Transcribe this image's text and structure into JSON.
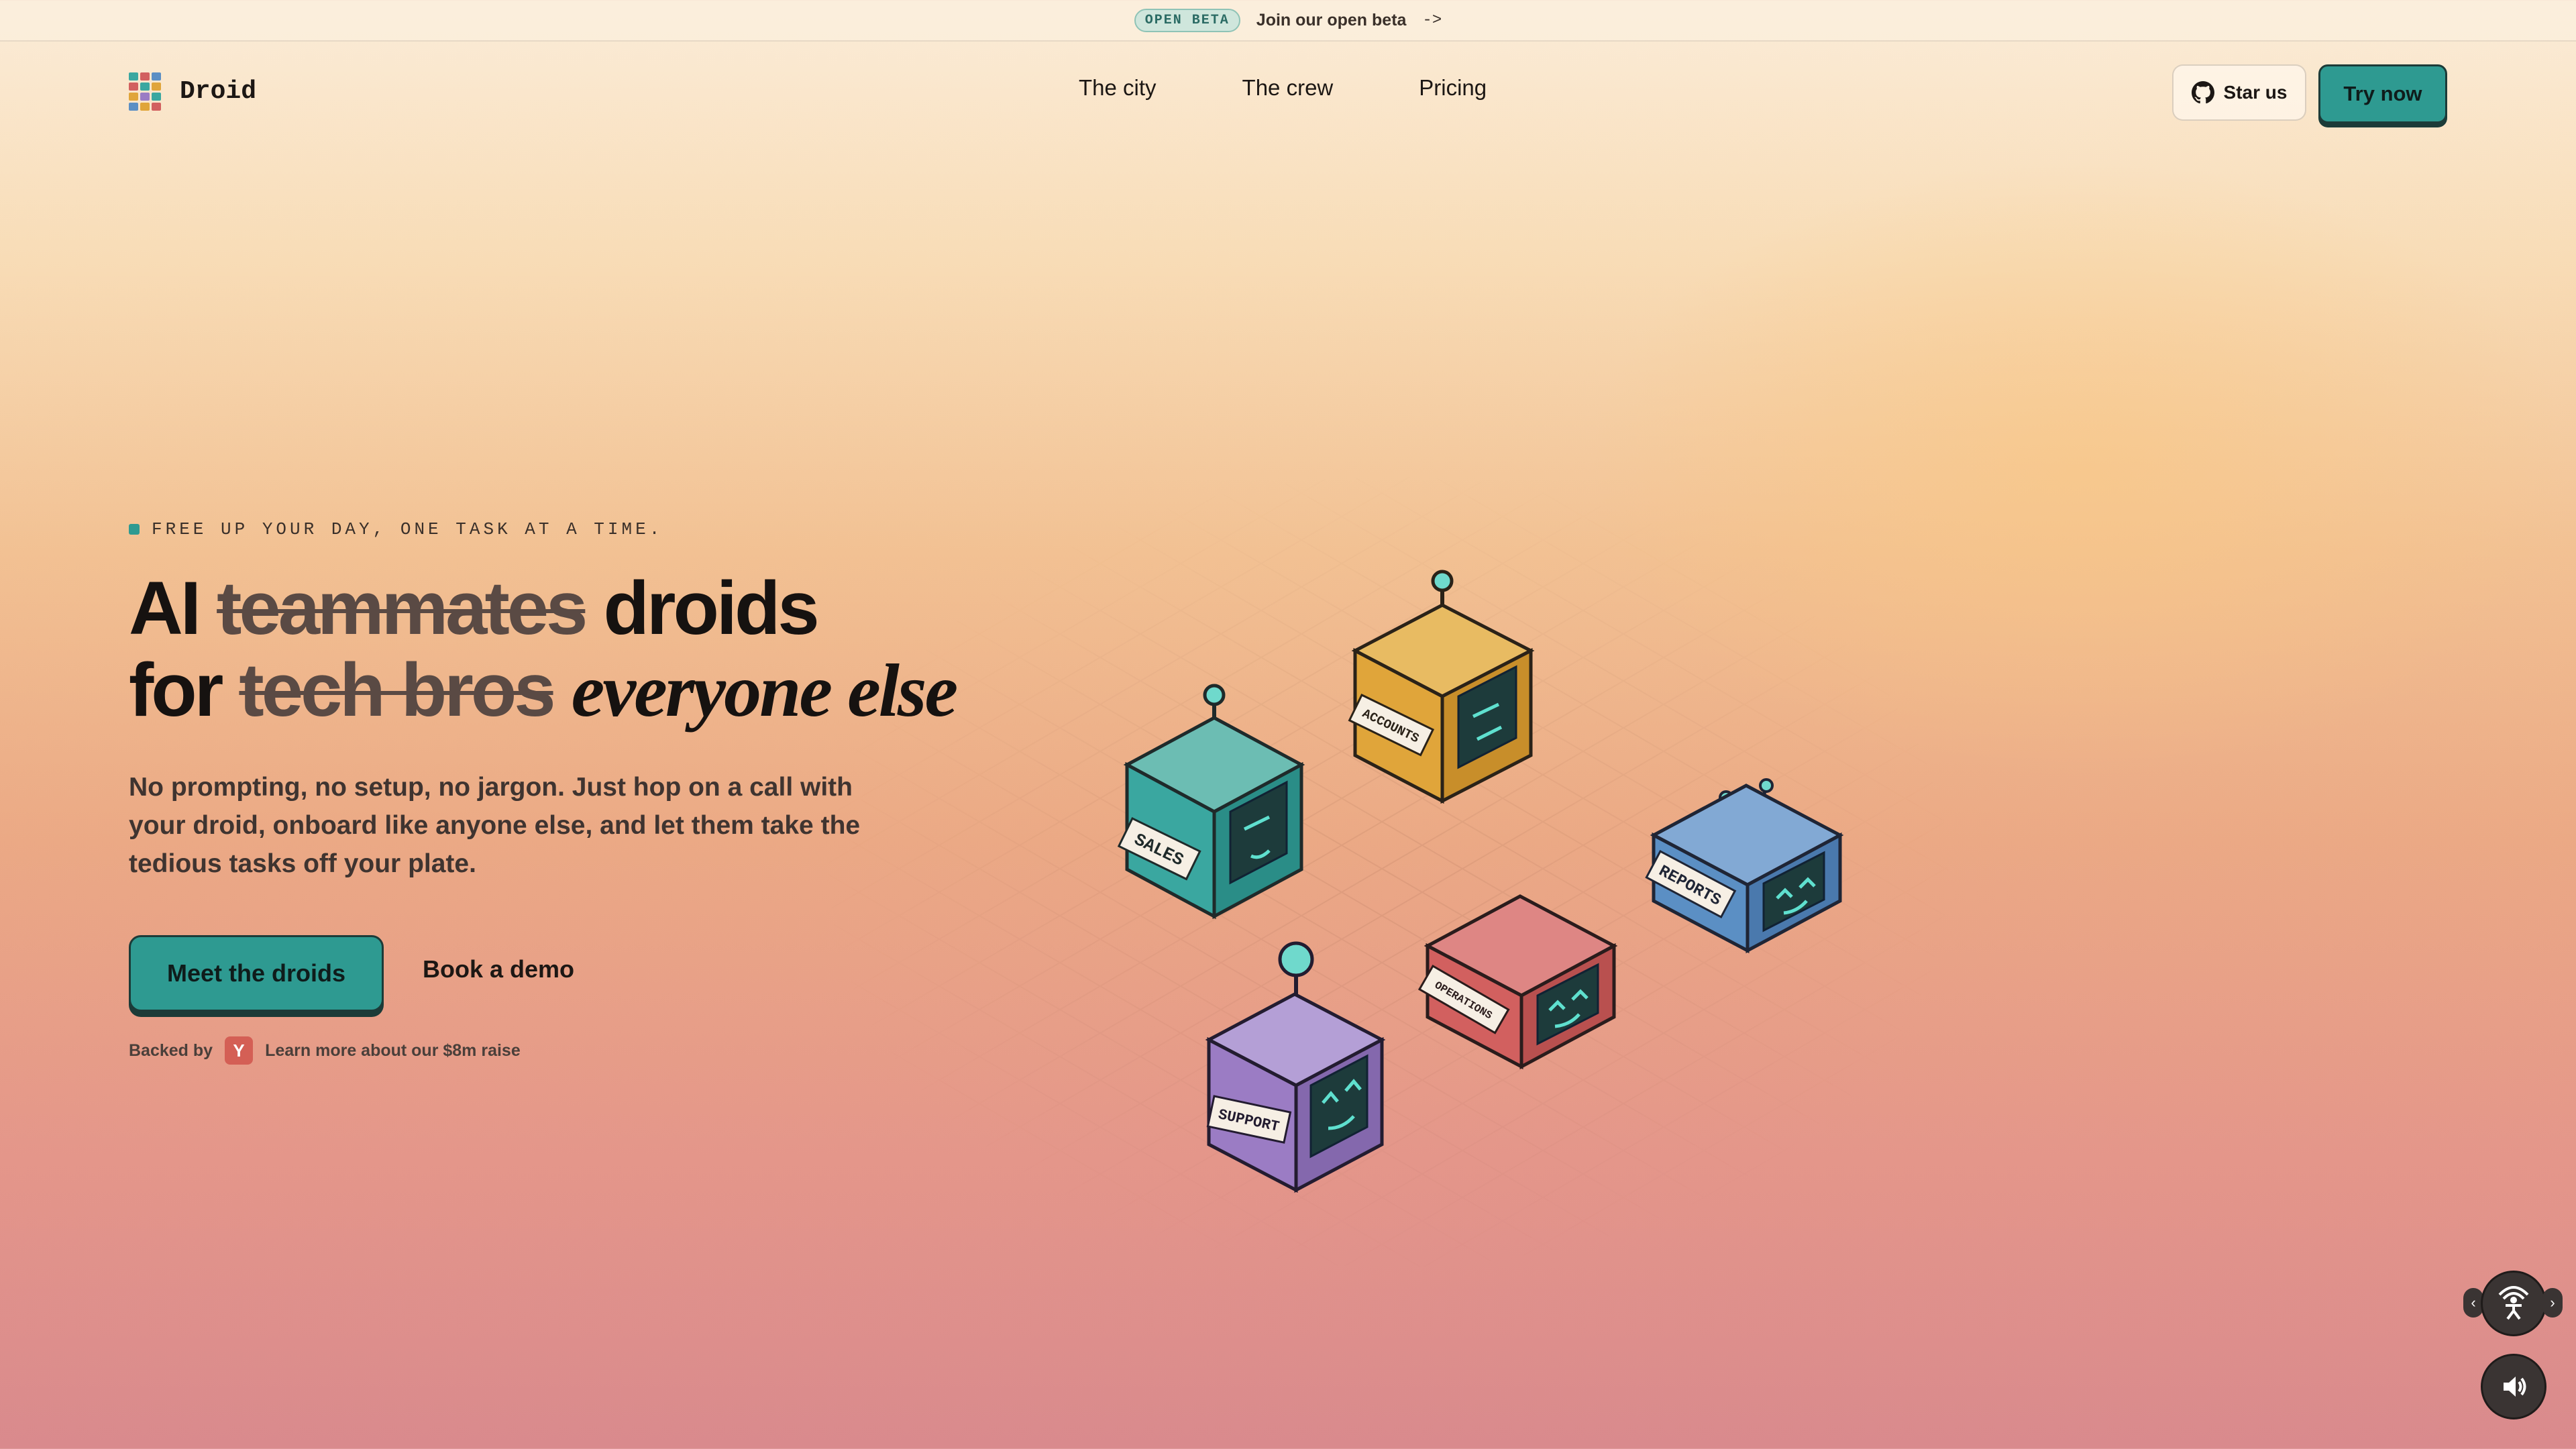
{
  "banner": {
    "badge": "OPEN BETA",
    "link": "Join our open beta",
    "arrow": "->"
  },
  "header": {
    "logo_text": "Droid",
    "nav": [
      "The city",
      "The crew",
      "Pricing"
    ],
    "star_label": "Star us",
    "try_label": "Try now"
  },
  "hero": {
    "tagline": "FREE UP YOUR DAY, ONE TASK AT A TIME.",
    "headline": {
      "line1_plain": "AI",
      "line1_struck": "teammates",
      "line1_end": "droids",
      "line2_plain": "for",
      "line2_struck": "tech bros",
      "line2_italic": "everyone else"
    },
    "subtitle": "No prompting, no setup, no jargon. Just hop on a call with your droid, onboard like anyone else, and let them take the tedious tasks off your plate.",
    "cta_primary": "Meet the droids",
    "cta_secondary": "Book a demo",
    "backed_label": "Backed by",
    "backed_badge": "Y",
    "raise_link": "Learn more about our $8m raise"
  },
  "droids": [
    {
      "label": "SALES",
      "color": "#3aa7a0"
    },
    {
      "label": "ACCOUNTS",
      "color": "#e0a53a"
    },
    {
      "label": "REPORTS",
      "color": "#5b8fc4"
    },
    {
      "label": "OPERATIONS",
      "color": "#d2605f"
    },
    {
      "label": "SUPPORT",
      "color": "#9b7cc4"
    }
  ],
  "controls": {
    "accessibility_icon": "accessibility-icon",
    "sound_icon": "speaker-icon",
    "prev": "‹",
    "next": "›"
  }
}
